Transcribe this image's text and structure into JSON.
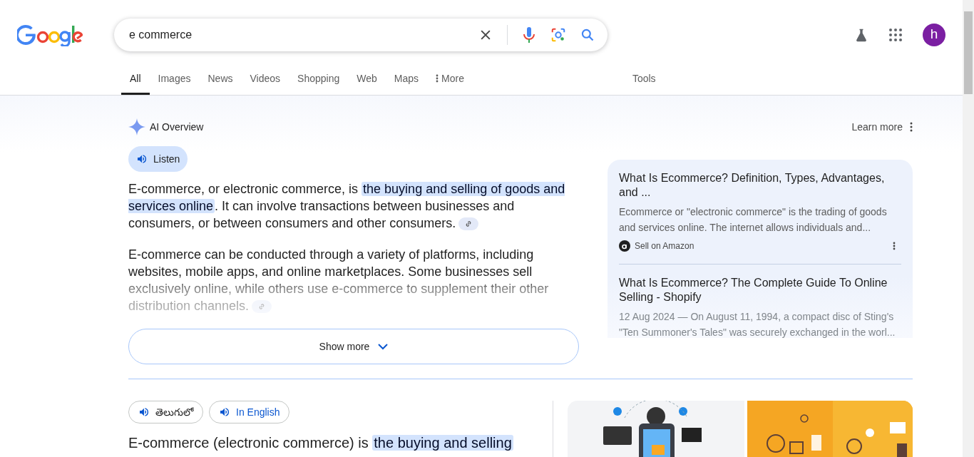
{
  "search": {
    "value": "e commerce"
  },
  "tabs": [
    {
      "label": "All",
      "selected": true
    },
    {
      "label": "Images",
      "selected": false
    },
    {
      "label": "News",
      "selected": false
    },
    {
      "label": "Videos",
      "selected": false
    },
    {
      "label": "Shopping",
      "selected": false
    },
    {
      "label": "Web",
      "selected": false
    },
    {
      "label": "Maps",
      "selected": false
    },
    {
      "label": "More",
      "selected": false,
      "kind": "more"
    }
  ],
  "tools": "Tools",
  "avatar": "h",
  "ai_overview": {
    "title": "AI Overview",
    "learn_more": "Learn more",
    "listen": "Listen",
    "paragraphs": [
      [
        {
          "text": "E-commerce, or electronic commerce, is ",
          "highlighted": false
        },
        {
          "text": "the buying and selling of goods and services online",
          "highlighted": true
        },
        {
          "text": ". It can involve transactions between businesses and consumers, or between consumers and other consumers.",
          "highlighted": false
        }
      ],
      [
        {
          "text": "E-commerce can be conducted through a variety of platforms, including websites, mobile apps, and online marketplaces. Some businesses sell exclusively online, while others use e-commerce to supplement their other distribution channels.",
          "highlighted": false
        }
      ]
    ],
    "sources": [
      {
        "title": "What Is Ecommerce? Definition, Types, Advantages, and ...",
        "snippet": "Ecommerce or \"electronic commerce\" is the trading of goods and services online. The internet allows individuals and...",
        "site": "Sell on Amazon"
      },
      {
        "title": "What Is Ecommerce? The Complete Guide To Online Selling - Shopify",
        "snippet": "12 Aug 2024 — On August 11, 1994, a compact disc of Sting's \"Ten Summoner's Tales\" was securely exchanged in the worl..."
      }
    ],
    "show_more": "Show more"
  },
  "languages": [
    {
      "label": "తెలుగులో"
    },
    {
      "label": "In English"
    }
  ],
  "answer": [
    {
      "text": "E-commerce (electronic commerce) is ",
      "highlighted": false
    },
    {
      "text": "the buying and selling",
      "highlighted": true
    }
  ]
}
